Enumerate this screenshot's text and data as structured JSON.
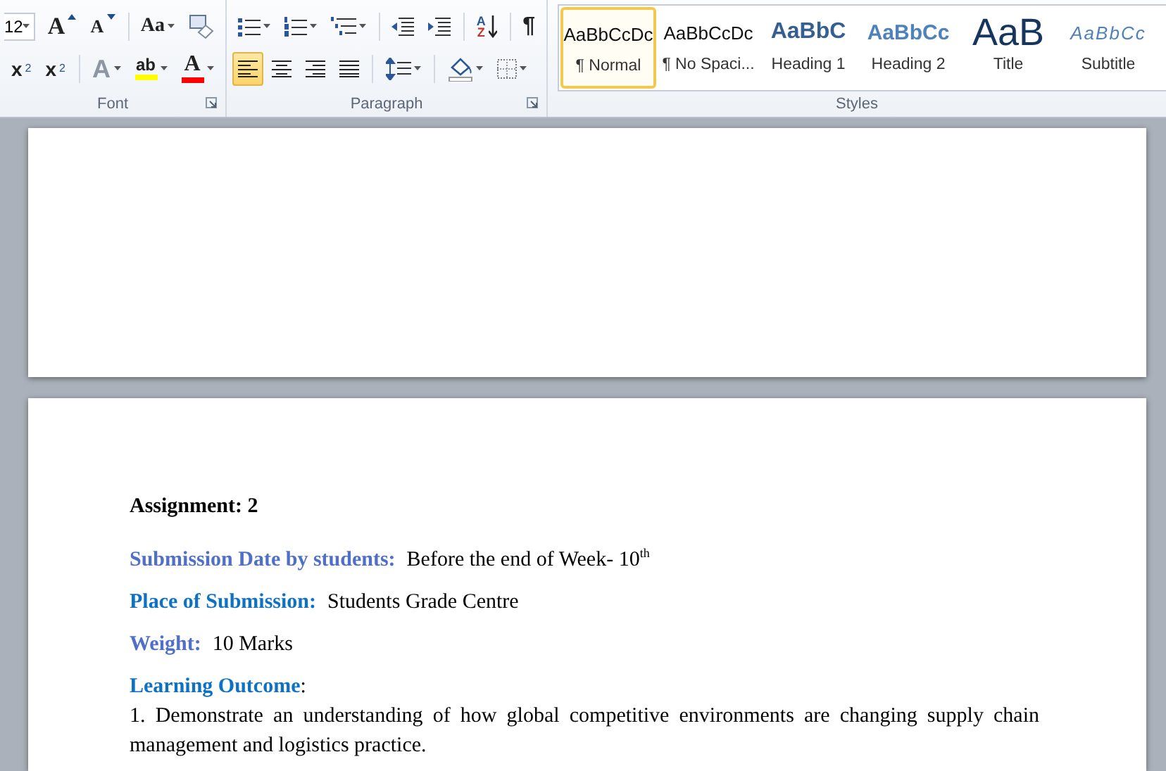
{
  "ribbon": {
    "font": {
      "label": "Font",
      "font_size": "12",
      "row1": [
        {
          "kind": "grow-font",
          "text": "A",
          "dropdown": false
        },
        {
          "kind": "shrink-font",
          "text": "A",
          "dropdown": false
        },
        {
          "kind": "change-case",
          "text": "Aa",
          "dropdown": true
        },
        {
          "kind": "clear-formatting",
          "dropdown": false
        }
      ],
      "row2": [
        {
          "kind": "subscript",
          "text": "x",
          "script": "2",
          "dropdown": false
        },
        {
          "kind": "superscript",
          "text": "x",
          "script": "2",
          "dropdown": false
        },
        {
          "kind": "text-effects",
          "text": "A",
          "dropdown": true,
          "disabled": true
        },
        {
          "kind": "highlight",
          "text": "ab",
          "dropdown": true,
          "color": "#ffff00"
        },
        {
          "kind": "font-color",
          "text": "A",
          "dropdown": true,
          "color": "#ff0000"
        }
      ]
    },
    "paragraph": {
      "label": "Paragraph",
      "row1": [
        {
          "kind": "bullets",
          "dropdown": true
        },
        {
          "kind": "numbering",
          "dropdown": true
        },
        {
          "kind": "multilevel-list",
          "dropdown": true
        },
        {
          "kind": "decrease-indent",
          "dropdown": false
        },
        {
          "kind": "increase-indent",
          "dropdown": false
        },
        {
          "kind": "sort",
          "letters": [
            "A",
            "Z"
          ],
          "dropdown": false
        },
        {
          "kind": "show-marks",
          "text": "¶",
          "dropdown": false
        }
      ],
      "row2": [
        {
          "kind": "align-left",
          "selected": true,
          "dropdown": false
        },
        {
          "kind": "align-center",
          "selected": false,
          "dropdown": false
        },
        {
          "kind": "align-right",
          "selected": false,
          "dropdown": false
        },
        {
          "kind": "justify",
          "selected": false,
          "dropdown": false
        },
        {
          "kind": "line-spacing",
          "dropdown": true
        },
        {
          "kind": "shading",
          "dropdown": true
        },
        {
          "kind": "borders",
          "dropdown": true
        }
      ]
    },
    "styles": {
      "label": "Styles",
      "items": [
        {
          "kind": "normal",
          "preview": "AaBbCcDc",
          "label": "¶ Normal",
          "selected": true
        },
        {
          "kind": "no-spacing",
          "preview": "AaBbCcDc",
          "label": "¶ No Spaci...",
          "selected": false
        },
        {
          "kind": "heading-1",
          "preview": "AaBbC",
          "label": "Heading 1",
          "selected": false
        },
        {
          "kind": "heading-2",
          "preview": "AaBbCc",
          "label": "Heading 2",
          "selected": false
        },
        {
          "kind": "title",
          "preview": "AaB",
          "label": "Title",
          "selected": false
        },
        {
          "kind": "subtitle",
          "preview": "AaBbCc",
          "label": "Subtitle",
          "selected": false
        }
      ]
    }
  },
  "document": {
    "blocks": [
      {
        "kind": "title",
        "text": "Assignment: 2"
      },
      {
        "kind": "field",
        "label": "Submission Date by students:",
        "value": "Before the end of Week- 10$^{th}$",
        "color": "#4f6fc8"
      },
      {
        "kind": "field",
        "label": "Place of Submission:",
        "value": "Students Grade Centre",
        "color": "#0e72c4"
      },
      {
        "kind": "field",
        "label": "Weight:",
        "value": "10 Marks",
        "color": "#4f6fc8"
      },
      {
        "kind": "heading",
        "label": "Learning Outcome",
        "suffix": ":",
        "color": "#0e72c4"
      },
      {
        "kind": "list-item",
        "text": "1. Demonstrate an understanding of how global competitive environments are changing supply chain management and logistics practice."
      }
    ]
  }
}
